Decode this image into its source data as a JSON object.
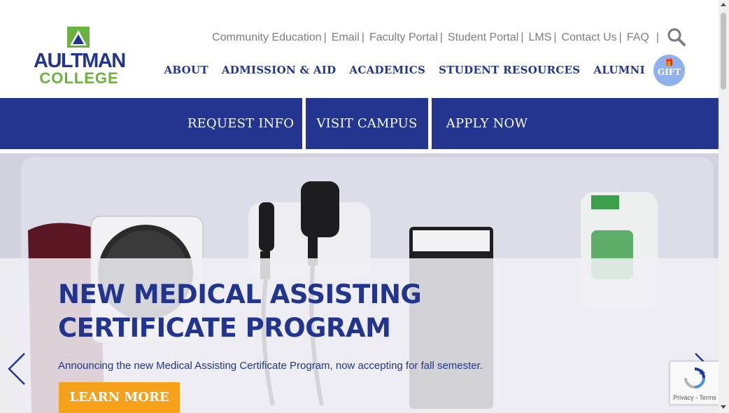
{
  "logo": {
    "name": "AULTMAN",
    "sub": "COLLEGE"
  },
  "util_nav": [
    {
      "label": "Community Education"
    },
    {
      "label": "Email"
    },
    {
      "label": "Faculty Portal"
    },
    {
      "label": "Student Portal"
    },
    {
      "label": "LMS"
    },
    {
      "label": "Contact Us"
    },
    {
      "label": "FAQ"
    }
  ],
  "util_sep": "|",
  "main_nav": [
    {
      "label": "ABOUT"
    },
    {
      "label": "ADMISSION & AID"
    },
    {
      "label": "ACADEMICS"
    },
    {
      "label": "STUDENT RESOURCES"
    },
    {
      "label": "ALUMNI"
    }
  ],
  "gift": {
    "label": "GIFT",
    "icon": "gift-icon"
  },
  "cta": [
    {
      "label": "REQUEST INFO"
    },
    {
      "label": "VISIT CAMPUS"
    },
    {
      "label": "APPLY NOW"
    }
  ],
  "hero": {
    "title": "NEW MEDICAL ASSISTING CERTIFICATE PROGRAM",
    "description": "Announcing the new Medical Assisting Certificate Program, now accepting for fall semester.",
    "button": "LEARN MORE"
  },
  "recaptcha": {
    "links": "Privacy - Terms"
  },
  "colors": {
    "brand_blue": "#21358f",
    "brand_green": "#6ab23e",
    "cta_orange": "#f5a11a",
    "gift_blue": "#8fb2ef"
  }
}
